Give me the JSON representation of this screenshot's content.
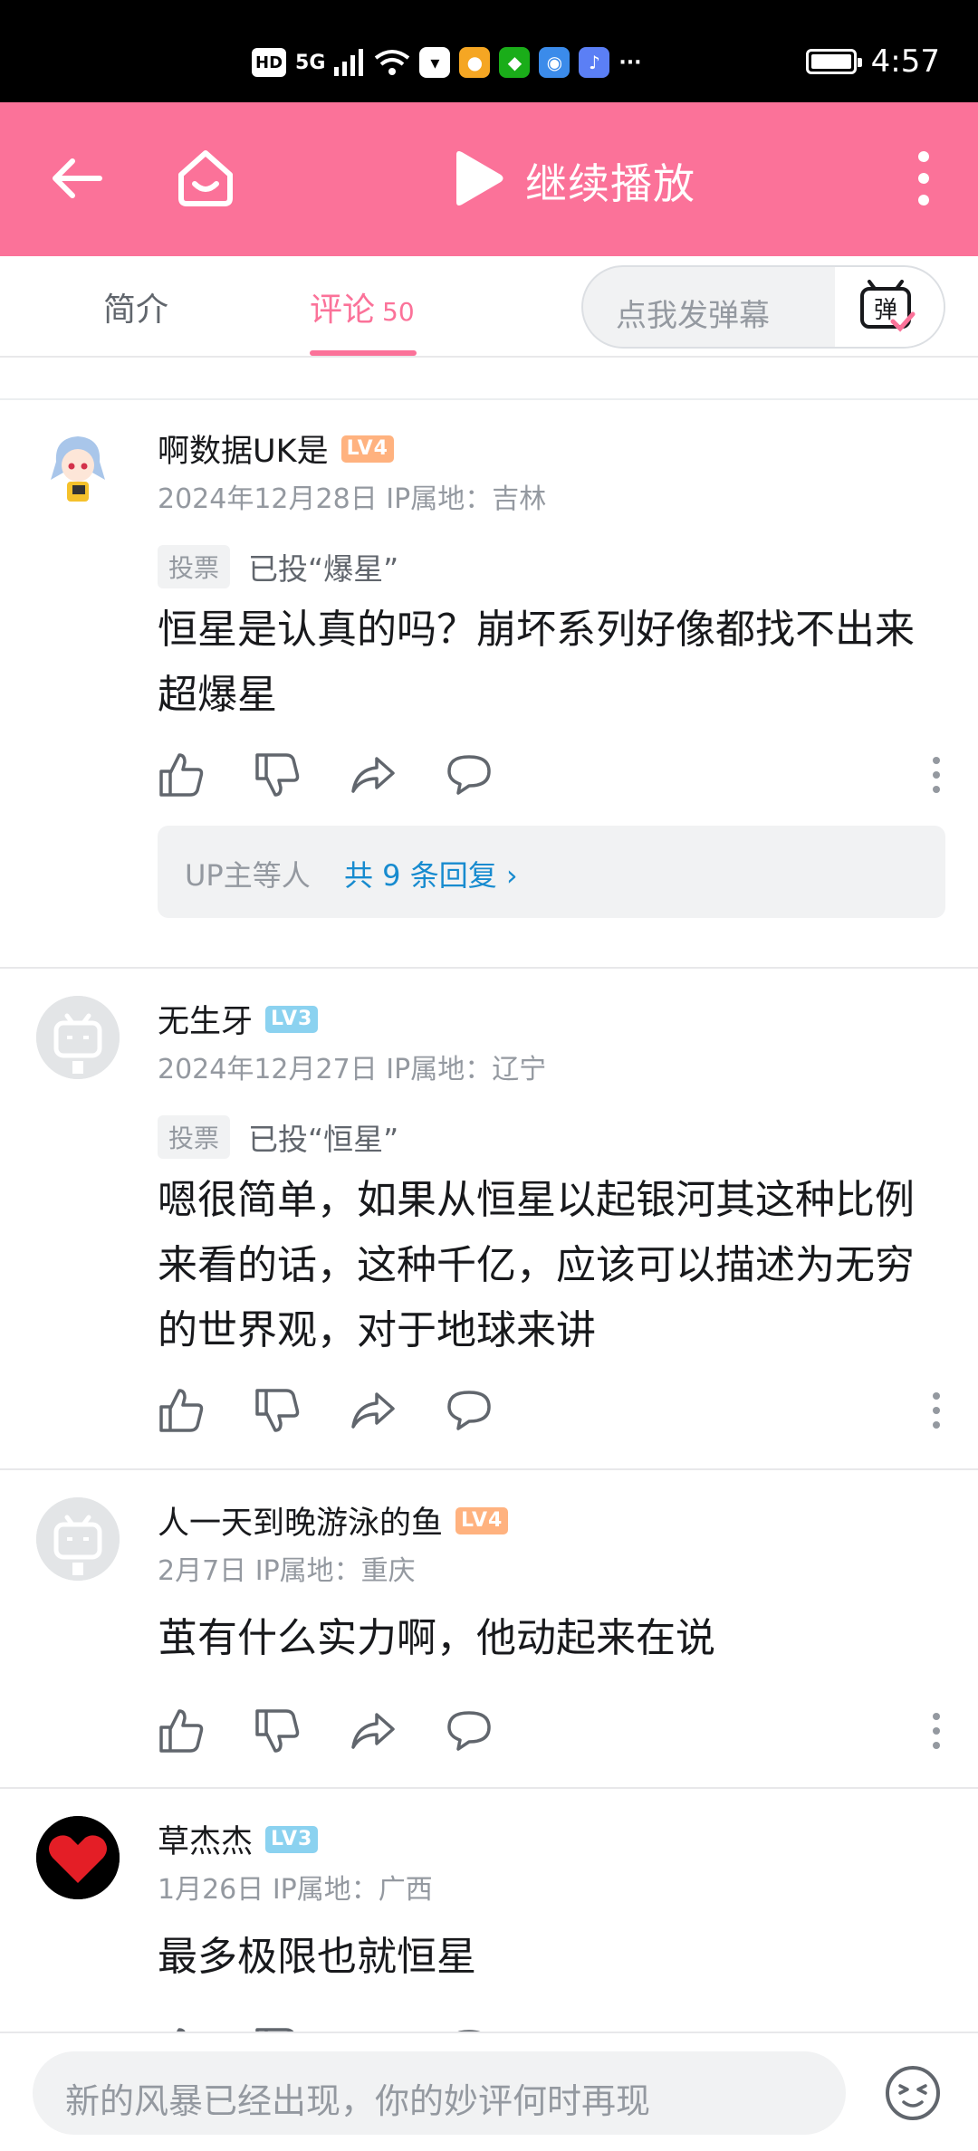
{
  "status_bar": {
    "hd": "HD",
    "network": "5G",
    "more": "···",
    "time": "4:57"
  },
  "header": {
    "title": "继续播放",
    "back_icon": "back-arrow-icon",
    "home_icon": "home-icon",
    "play_icon": "play-icon",
    "more_icon": "more-vertical-icon",
    "brand_color": "#fb7299"
  },
  "tabs": {
    "intro": "简介",
    "comments": "评论",
    "comments_count": "50",
    "danmaku_placeholder": "点我发弹幕",
    "danmaku_icon": "danmaku-toggle-icon"
  },
  "comments": [
    {
      "username": "啊数据UK是",
      "level": "LV4",
      "date": "2024年12月28日",
      "ip": "IP属地：吉林",
      "vote_tag": "投票",
      "vote_text": "已投“爆星”",
      "text": "恒星是认真的吗？崩坏系列好像都找不出来超爆星",
      "reply_who": "UP主等人",
      "reply_count": "共 9 条回复 ›"
    },
    {
      "username": "无生牙",
      "level": "LV3",
      "date": "2024年12月27日",
      "ip": "IP属地：辽宁",
      "vote_tag": "投票",
      "vote_text": "已投“恒星”",
      "text": "嗯很简单，如果从恒星以起银河其这种比例来看的话，这种千亿，应该可以描述为无穷的世界观，对于地球来讲"
    },
    {
      "username": "人一天到晚游泳的鱼",
      "level": "LV4",
      "date": "2月7日",
      "ip": "IP属地：重庆",
      "text": "茧有什么实力啊，他动起来在说"
    },
    {
      "username": "草杰杰",
      "level": "LV3",
      "date": "1月26日",
      "ip": "IP属地：广西",
      "text": "最多极限也就恒星"
    }
  ],
  "bottom": {
    "placeholder": "新的风暴已经出现，你的妙评何时再现",
    "emoji_icon": "emoji-icon"
  }
}
